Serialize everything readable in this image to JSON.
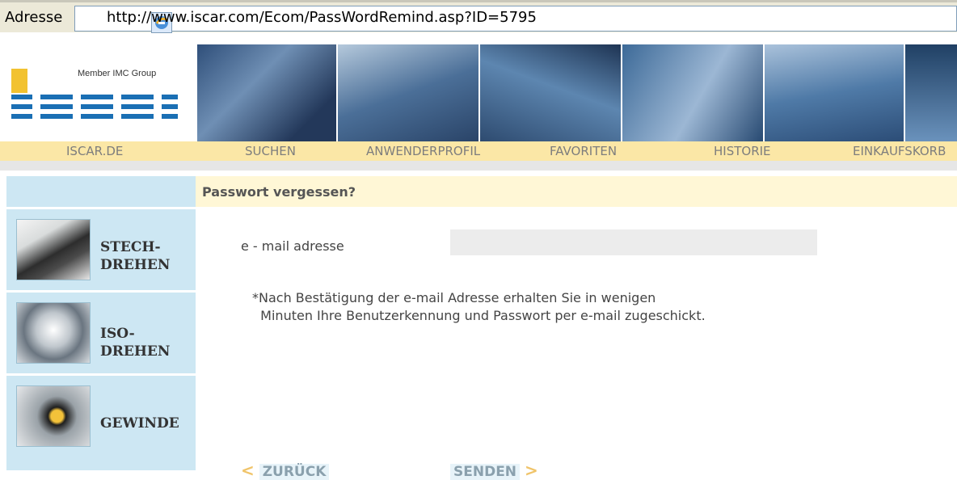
{
  "browser": {
    "address_label": "Adresse",
    "url": "http://www.iscar.com/Ecom/PassWordRemind.asp?ID=5795"
  },
  "header": {
    "logo_tagline": "Member IMC Group",
    "logo_text": "iscar"
  },
  "nav": {
    "items": [
      "ISCAR.DE",
      "SUCHEN",
      "ANWENDERPROFIL",
      "FAVORITEN",
      "HISTORIE",
      "EINKAUFSKORB"
    ]
  },
  "sidebar": {
    "items": [
      {
        "label_line1": "STECH-",
        "label_line2": "DREHEN"
      },
      {
        "label_line1": "ISO-",
        "label_line2": "DREHEN"
      },
      {
        "label_line1": "GEWINDE",
        "label_line2": ""
      }
    ]
  },
  "form": {
    "title": "Passwort vergessen?",
    "email_label": "e - mail adresse",
    "email_value": "",
    "note_line1": "*Nach Bestätigung der e-mail Adresse erhalten Sie in wenigen",
    "note_line2": "  Minuten Ihre Benutzerkennung und Passwort per e-mail zugeschickt.",
    "back_label": "ZURÜCK",
    "send_label": "SENDEN"
  }
}
